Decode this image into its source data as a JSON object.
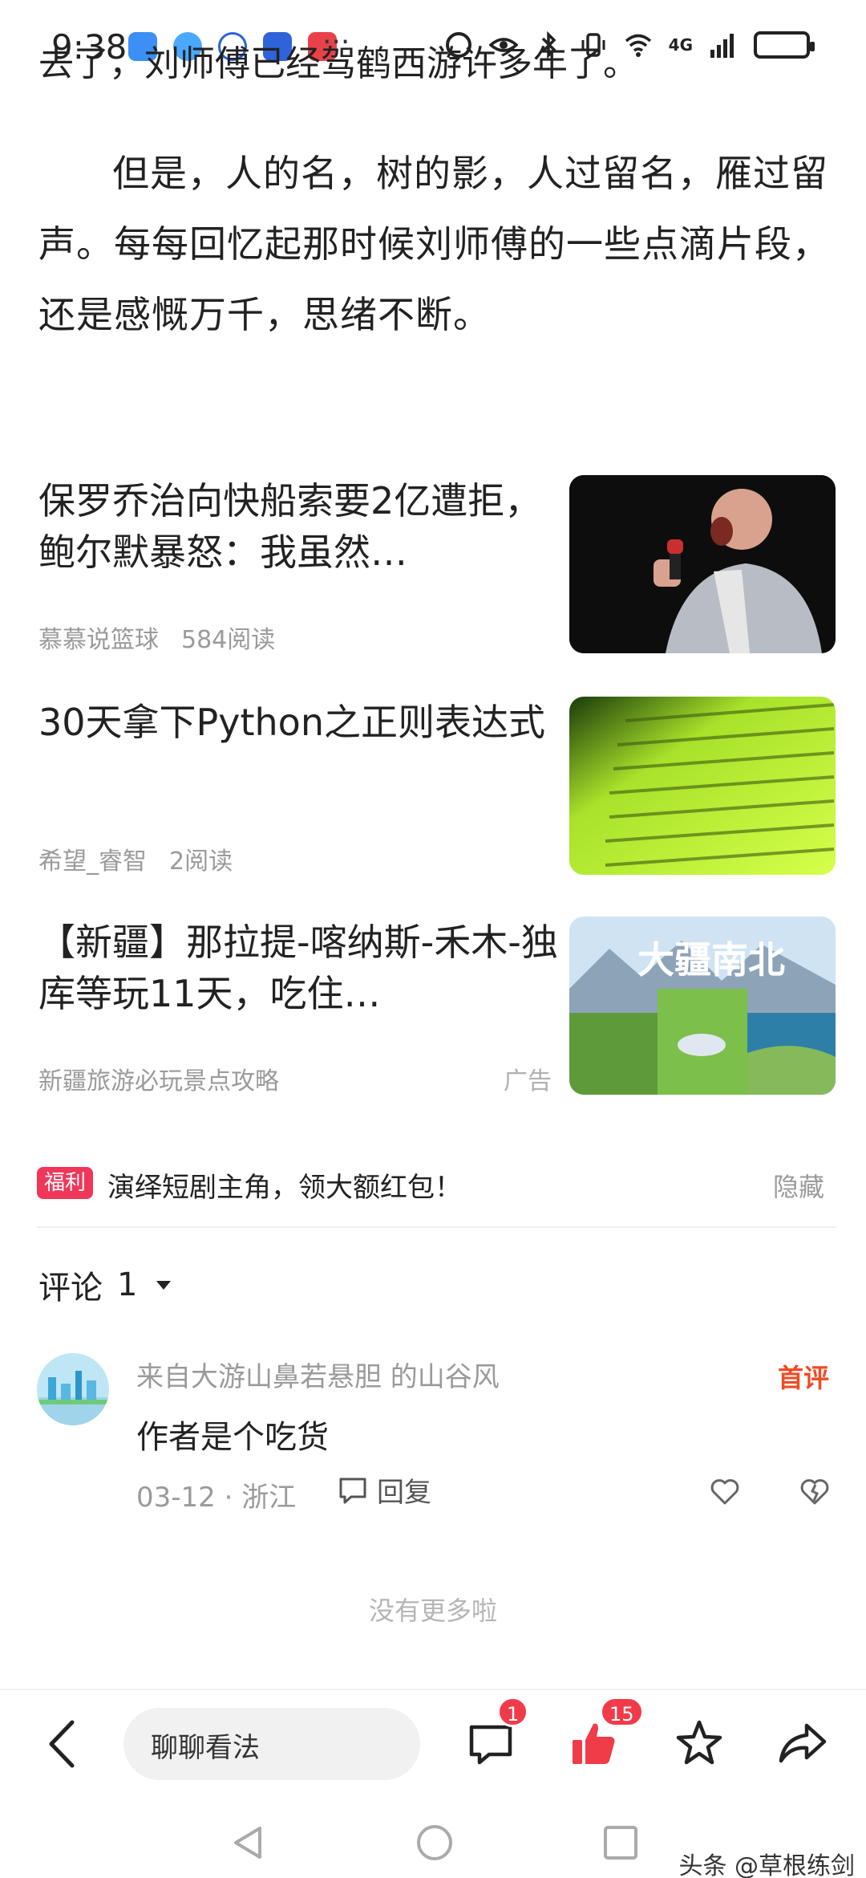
{
  "status_bar": {
    "time": "9:38",
    "more": "···",
    "network": "4G"
  },
  "article": {
    "cut_line": "去了，刘师傅已经驾鹤西游许多年了。",
    "paragraph": "但是，人的名，树的影，人过留名，雁过留声。每每回忆起那时候刘师傅的一些点滴片段，还是感慨万千，思绪不断。"
  },
  "related": [
    {
      "title": "保罗乔治向快船索要2亿遭拒，鲍尔默暴怒：我虽然…",
      "author": "慕慕说篮球",
      "reads": "584阅读"
    },
    {
      "title": "30天拿下Python之正则表达式",
      "author": "希望_睿智",
      "reads": "2阅读"
    },
    {
      "title": "【新疆】那拉提-喀纳斯-禾木-独库等玩11天，吃住…",
      "author": "新疆旅游必玩景点攻略",
      "ad": "广告",
      "thumb_text": "大疆南北"
    }
  ],
  "promo": {
    "badge": "福利",
    "text": "演绎短剧主角，领大额红包！",
    "hide": "隐藏"
  },
  "comments": {
    "label": "评论",
    "count": "1",
    "items": [
      {
        "user": "来自大游山鼻若悬胆 的山谷风",
        "tag": "首评",
        "text": "作者是个吃货",
        "date": "03-12 · 浙江",
        "reply": "回复"
      }
    ],
    "no_more": "没有更多啦"
  },
  "bottom_bar": {
    "input_placeholder": "聊聊看法",
    "comment_badge": "1",
    "like_badge": "15"
  },
  "watermark": "头条 @草根练剑",
  "colors": {
    "accent_red": "#f23b4a",
    "first_tag": "#f04b24"
  }
}
